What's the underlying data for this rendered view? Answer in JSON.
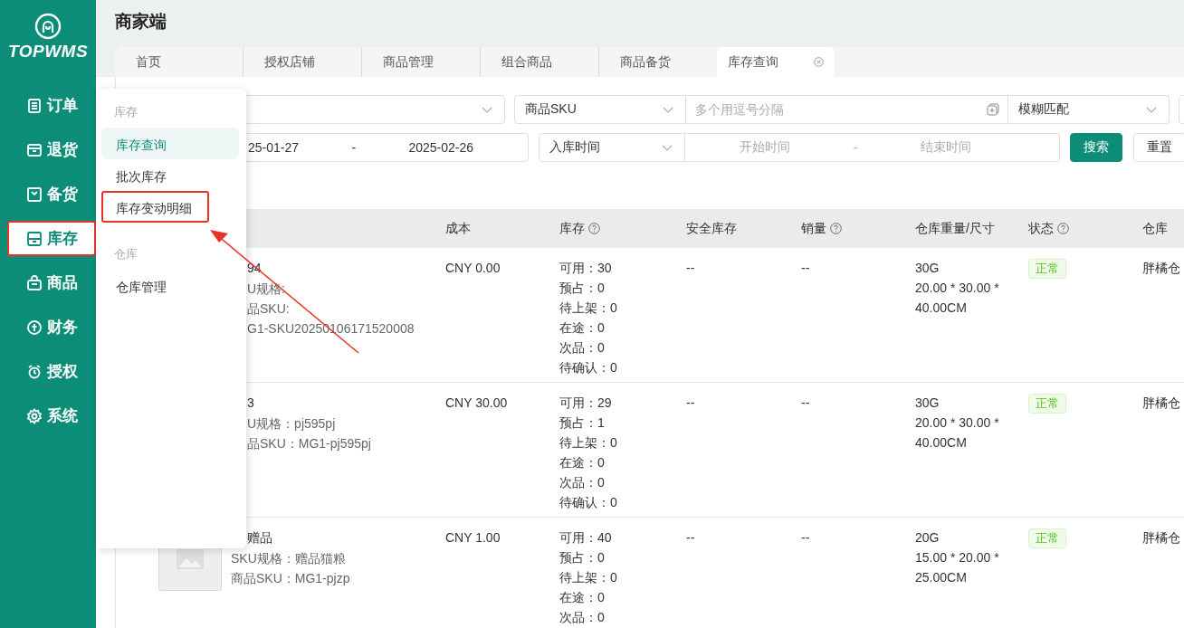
{
  "brand": {
    "name": "TOPWMS"
  },
  "sidebar": {
    "items": [
      {
        "label": "订单",
        "selected": false,
        "highlighted": false
      },
      {
        "label": "退货",
        "selected": false,
        "highlighted": false
      },
      {
        "label": "备货",
        "selected": false,
        "highlighted": false
      },
      {
        "label": "库存",
        "selected": true,
        "highlighted": true
      },
      {
        "label": "商品",
        "selected": false,
        "highlighted": false
      },
      {
        "label": "财务",
        "selected": false,
        "highlighted": false
      },
      {
        "label": "授权",
        "selected": false,
        "highlighted": false
      },
      {
        "label": "系统",
        "selected": false,
        "highlighted": false
      }
    ]
  },
  "header": {
    "title": "商家端"
  },
  "tabs": [
    {
      "label": "首页",
      "selected": false,
      "closable": false
    },
    {
      "label": "授权店铺",
      "selected": false,
      "closable": false
    },
    {
      "label": "商品管理",
      "selected": false,
      "closable": false
    },
    {
      "label": "组合商品",
      "selected": false,
      "closable": false
    },
    {
      "label": "商品备货",
      "selected": false,
      "closable": false
    },
    {
      "label": "库存查询",
      "selected": true,
      "closable": true
    }
  ],
  "filters": {
    "row_1": [
      {
        "kind": "select"
      },
      {
        "kind": "select",
        "value": "商品SKU"
      },
      {
        "kind": "input",
        "placeholder": "多个用逗号分隔"
      },
      {
        "kind": "select",
        "value": "模糊匹配"
      },
      {
        "kind": "stub"
      }
    ],
    "row_2": [
      {
        "kind": "range",
        "start": "25-01-27",
        "separator": "-",
        "end": "2025-02-26",
        "placeholder": false
      },
      {
        "kind": "select",
        "value": "入库时间"
      },
      {
        "kind": "range",
        "start": "开始时间",
        "separator": "-",
        "end": "结束时间",
        "placeholder": true
      },
      {
        "kind": "primary",
        "label": "搜索"
      },
      {
        "kind": "button",
        "label": "重置"
      }
    ]
  },
  "table": {
    "columns": [
      {
        "label": "成本",
        "help": false
      },
      {
        "label": "库存",
        "help": true
      },
      {
        "label": "安全库存",
        "help": false
      },
      {
        "label": "销量",
        "help": true
      },
      {
        "label": "仓库重量/尺寸",
        "help": false
      },
      {
        "label": "状态",
        "help": true
      },
      {
        "label": "仓库",
        "help": false
      }
    ],
    "rows": [
      {
        "thumbnail": false,
        "product": [
          "94",
          "U规格:",
          "品SKU:",
          "G1-SKU20250106171520008"
        ],
        "cost": "CNY 0.00",
        "stock": [
          "可用：30",
          "预占：0",
          "待上架：0",
          "在途：0",
          "次品：0",
          "待确认：0"
        ],
        "safety_stock": "--",
        "sales": "--",
        "weight_size": [
          "30G",
          "20.00 * 30.00 *",
          "40.00CM"
        ],
        "status": "正常",
        "warehouse": "胖橘仓"
      },
      {
        "thumbnail": false,
        "product": [
          "3",
          "U规格：pj595pj",
          "品SKU：MG1-pj595pj"
        ],
        "cost": "CNY 30.00",
        "stock": [
          "可用：29",
          "预占：1",
          "待上架：0",
          "在途：0",
          "次品：0",
          "待确认：0"
        ],
        "safety_stock": "--",
        "sales": "--",
        "weight_size": [
          "30G",
          "20.00 * 30.00 *",
          "40.00CM"
        ],
        "status": "正常",
        "warehouse": "胖橘仓"
      },
      {
        "thumbnail": true,
        "product": [
          "赠品",
          "SKU规格：赠品猫粮",
          "商品SKU：MG1-pjzp"
        ],
        "cost": "CNY 1.00",
        "stock": [
          "可用：40",
          "预占：0",
          "待上架：0",
          "在途：0",
          "次品：0"
        ],
        "safety_stock": "--",
        "sales": "--",
        "weight_size": [
          "20G",
          "15.00 * 20.00 *",
          "25.00CM"
        ],
        "status": "正常",
        "warehouse": "胖橘仓"
      }
    ]
  },
  "flyout_menu": {
    "groups": [
      {
        "title": "库存",
        "items": [
          {
            "label": "库存查询",
            "selected": true,
            "highlighted": false
          },
          {
            "label": "批次库存",
            "selected": false,
            "highlighted": false
          },
          {
            "label": "库存变动明细",
            "selected": false,
            "highlighted": true
          }
        ]
      },
      {
        "title": "仓库",
        "items": [
          {
            "label": "仓库管理",
            "selected": false,
            "highlighted": false
          }
        ]
      }
    ]
  },
  "annotation_arrow": true
}
